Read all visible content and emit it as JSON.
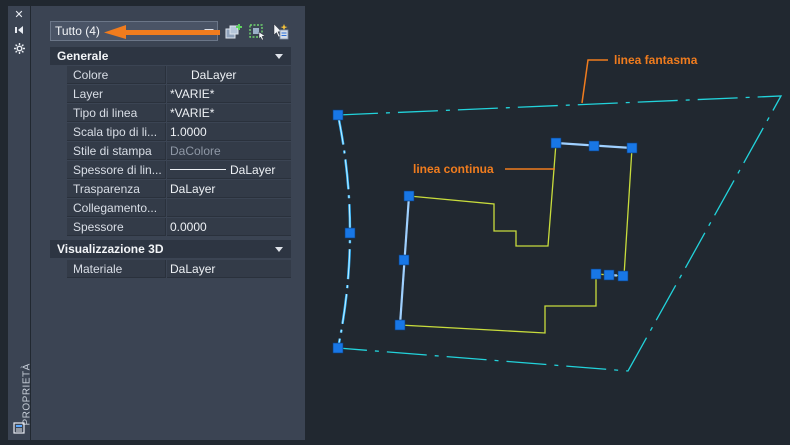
{
  "palette": {
    "title": "PROPRIETÀ",
    "icons": [
      "close-icon",
      "auto-hide-icon",
      "settings-icon",
      "properties-icon"
    ]
  },
  "panel": {
    "selector": {
      "value": "Tutto (4)"
    },
    "toolbar": [
      "toggle-pickadd-icon",
      "select-objects-icon",
      "quick-select-icon"
    ],
    "sections": [
      {
        "title": "Generale",
        "rows": [
          {
            "name": "Colore",
            "value": "DaLayer"
          },
          {
            "name": "Layer",
            "value": "*VARIE*"
          },
          {
            "name": "Tipo di linea",
            "value": "*VARIE*"
          },
          {
            "name": "Scala tipo di li...",
            "value": "1.0000"
          },
          {
            "name": "Stile di stampa",
            "value": "DaColore"
          },
          {
            "name": "Spessore di lin...",
            "value": "DaLayer"
          },
          {
            "name": "Trasparenza",
            "value": "DaLayer"
          },
          {
            "name": "Collegamento...",
            "value": ""
          },
          {
            "name": "Spessore",
            "value": "0.0000"
          }
        ]
      },
      {
        "title": "Visualizzazione 3D",
        "rows": [
          {
            "name": "Materiale",
            "value": "DaLayer"
          }
        ]
      }
    ]
  },
  "drawing": {
    "annotations": {
      "phantom": "linea fantasma",
      "continuous": "linea continua"
    }
  },
  "colors": {
    "annotation": "#f07c1e",
    "phantom_line": "#22d3db",
    "continuous_line": "#c8dc3c",
    "grip": "#1a73e8",
    "background": "#212830",
    "panel": "#3b4453"
  }
}
